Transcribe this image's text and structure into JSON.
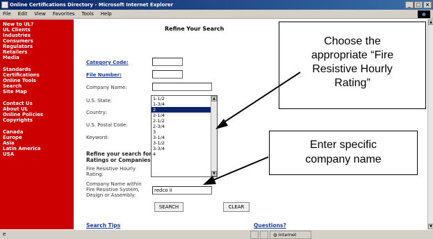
{
  "window": {
    "title": "Online Certifications Directory - Microsoft Internet Explorer",
    "buttons": [
      "_",
      "□",
      "×"
    ]
  },
  "menubar": [
    "File",
    "Edit",
    "View",
    "Favorites",
    "Tools",
    "Help"
  ],
  "leftnav": {
    "groups": [
      [
        "New to UL?",
        "UL Clients",
        "Industries",
        "Consumers",
        "Regulators",
        "Retailers",
        "Media"
      ],
      [
        "Standards",
        "Certifications",
        "Online Tools",
        "Search",
        "Site Map"
      ],
      [
        "Contact Us",
        "About UL",
        "Online Policies",
        "Copyrights"
      ],
      [
        "Canada",
        "Europe",
        "Asia",
        "Latin America",
        "USA"
      ]
    ]
  },
  "page": {
    "title": "Refine Your Search",
    "category_code": "Category Code:",
    "file_number": "File Number:",
    "company_name": "Company Name:",
    "us_state": "U.S. State:",
    "country": "Country:",
    "postal_code": "U.S. Postal Code:",
    "keyword": "Keyword:",
    "refine_line1": "Refine your search for",
    "refine_line2": "Ratings or Companies",
    "fire_label1": "Fire Resistive Hourly",
    "fire_label2": "Rating:",
    "fire_value": "2",
    "company_within1": "Company Name within",
    "company_within2": "Fire Resistive System,",
    "company_within3": "Design or Assembly:",
    "company_within_value": "redco ii",
    "search_button": "SEARCH",
    "clear_button": "CLEAR",
    "search_tips": "Search Tips",
    "questions": "Questions?"
  },
  "listbox": {
    "options": [
      "1-1/2",
      "1-3/4",
      "2",
      "2-1/4",
      "2-1/2",
      "2-3/4",
      "3",
      "3-1/4",
      "3-1/2",
      "3-3/4",
      "4"
    ],
    "selected": "2"
  },
  "statusbar": {
    "zone": "Internet"
  },
  "callouts": {
    "fire_rating": [
      "Choose the",
      "appropriate “Fire",
      "Resistive Hourly",
      "Rating”"
    ],
    "company": [
      "Enter specific",
      "company name"
    ]
  }
}
